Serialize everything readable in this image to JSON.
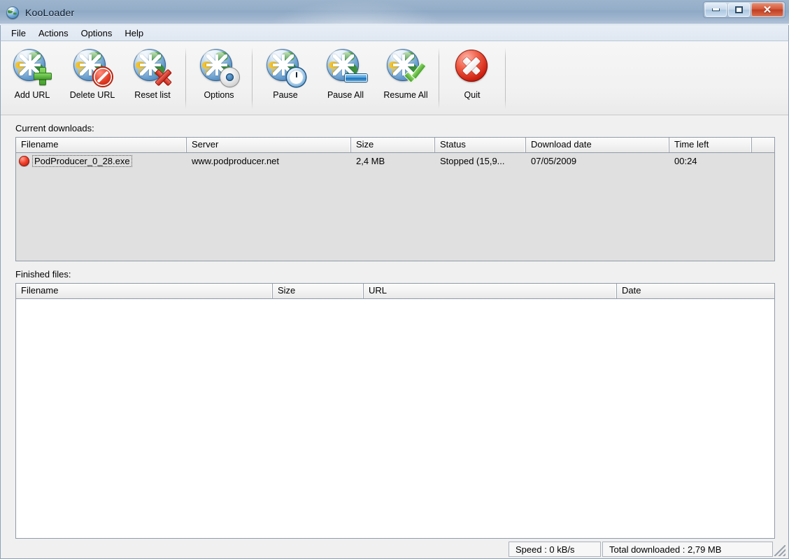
{
  "window": {
    "title": "KooLoader",
    "app_icon": "globe-icon",
    "controls": {
      "minimize": "minimize-button",
      "maximize": "maximize-button",
      "close_label": "✕"
    }
  },
  "menubar": {
    "items": [
      {
        "label": "File"
      },
      {
        "label": "Actions"
      },
      {
        "label": "Options"
      },
      {
        "label": "Help"
      }
    ]
  },
  "toolbar": {
    "buttons": [
      {
        "label": "Add URL",
        "icon": "globe-plus-icon"
      },
      {
        "label": "Delete URL",
        "icon": "globe-deny-icon"
      },
      {
        "label": "Reset list",
        "icon": "globe-x-icon"
      },
      {
        "label": "Options",
        "icon": "globe-gear-icon"
      },
      {
        "label": "Pause",
        "icon": "globe-clock-icon"
      },
      {
        "label": "Pause All",
        "icon": "globe-bar-icon"
      },
      {
        "label": "Resume All",
        "icon": "globe-check-icon"
      },
      {
        "label": "Quit",
        "icon": "red-x-circle-icon"
      }
    ]
  },
  "current_downloads": {
    "label": "Current downloads:",
    "columns": [
      {
        "name": "Filename"
      },
      {
        "name": "Server"
      },
      {
        "name": "Size"
      },
      {
        "name": "Status"
      },
      {
        "name": "Download date"
      },
      {
        "name": "Time left"
      },
      {
        "name": ""
      }
    ],
    "rows": [
      {
        "status_icon": "red-sphere-icon",
        "filename": "PodProducer_0_28.exe",
        "server": "www.podproducer.net",
        "size": "2,4 MB",
        "status": "Stopped (15,9...",
        "download_date": "07/05/2009",
        "time_left": "00:24"
      }
    ]
  },
  "finished_files": {
    "label": "Finished files:",
    "columns": [
      {
        "name": "Filename"
      },
      {
        "name": "Size"
      },
      {
        "name": "URL"
      },
      {
        "name": "Date"
      }
    ],
    "rows": []
  },
  "statusbar": {
    "speed": "Speed : 0 kB/s",
    "total": "Total downloaded : 2,79 MB",
    "grip": "resize-grip-icon"
  },
  "colors": {
    "titlebar": "#94adc8",
    "accent_close": "#bf3d22",
    "list_bg": "#e0e0e0",
    "panel_bg": "#f0f0f0",
    "status_red": "#f0402a"
  }
}
